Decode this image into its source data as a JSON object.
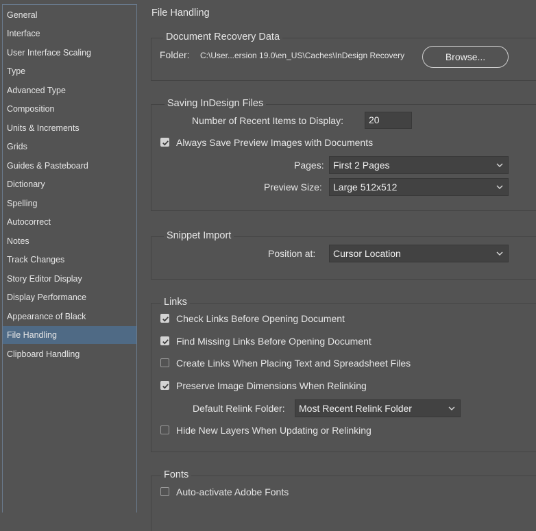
{
  "sidebar": {
    "items": [
      {
        "label": "General"
      },
      {
        "label": "Interface"
      },
      {
        "label": "User Interface Scaling"
      },
      {
        "label": "Type"
      },
      {
        "label": "Advanced Type"
      },
      {
        "label": "Composition"
      },
      {
        "label": "Units & Increments"
      },
      {
        "label": "Grids"
      },
      {
        "label": "Guides & Pasteboard"
      },
      {
        "label": "Dictionary"
      },
      {
        "label": "Spelling"
      },
      {
        "label": "Autocorrect"
      },
      {
        "label": "Notes"
      },
      {
        "label": "Track Changes"
      },
      {
        "label": "Story Editor Display"
      },
      {
        "label": "Display Performance"
      },
      {
        "label": "Appearance of Black"
      },
      {
        "label": "File Handling"
      },
      {
        "label": "Clipboard Handling"
      }
    ],
    "selected": "File Handling"
  },
  "page_title": "File Handling",
  "recovery": {
    "title": "Document Recovery Data",
    "folder_label": "Folder:",
    "folder_path": "C:\\User...ersion 19.0\\en_US\\Caches\\InDesign Recovery",
    "browse_label": "Browse..."
  },
  "saving": {
    "title": "Saving InDesign Files",
    "recent_label": "Number of Recent Items to Display:",
    "recent_value": "20",
    "preview_label": "Always Save Preview Images with Documents",
    "preview_checked": true,
    "pages_label": "Pages:",
    "pages_value": "First 2 Pages",
    "size_label": "Preview Size:",
    "size_value": "Large 512x512"
  },
  "snippet": {
    "title": "Snippet Import",
    "position_label": "Position at:",
    "position_value": "Cursor Location"
  },
  "links": {
    "title": "Links",
    "check_links": {
      "label": "Check Links Before Opening Document",
      "checked": true
    },
    "find_missing": {
      "label": "Find Missing Links Before Opening Document",
      "checked": true
    },
    "create_links": {
      "label": "Create Links When Placing Text and Spreadsheet Files",
      "checked": false
    },
    "preserve_dims": {
      "label": "Preserve Image Dimensions When Relinking",
      "checked": true
    },
    "relink_label": "Default Relink Folder:",
    "relink_value": "Most Recent Relink Folder",
    "hide_layers": {
      "label": "Hide New Layers When Updating or Relinking",
      "checked": false
    }
  },
  "fonts": {
    "title": "Fonts",
    "auto_activate": {
      "label": "Auto-activate Adobe Fonts",
      "checked": false
    }
  },
  "colors": {
    "background": "#535353",
    "selected_item": "#4f6a85",
    "field": "#424242",
    "text": "#e6e6e6"
  }
}
